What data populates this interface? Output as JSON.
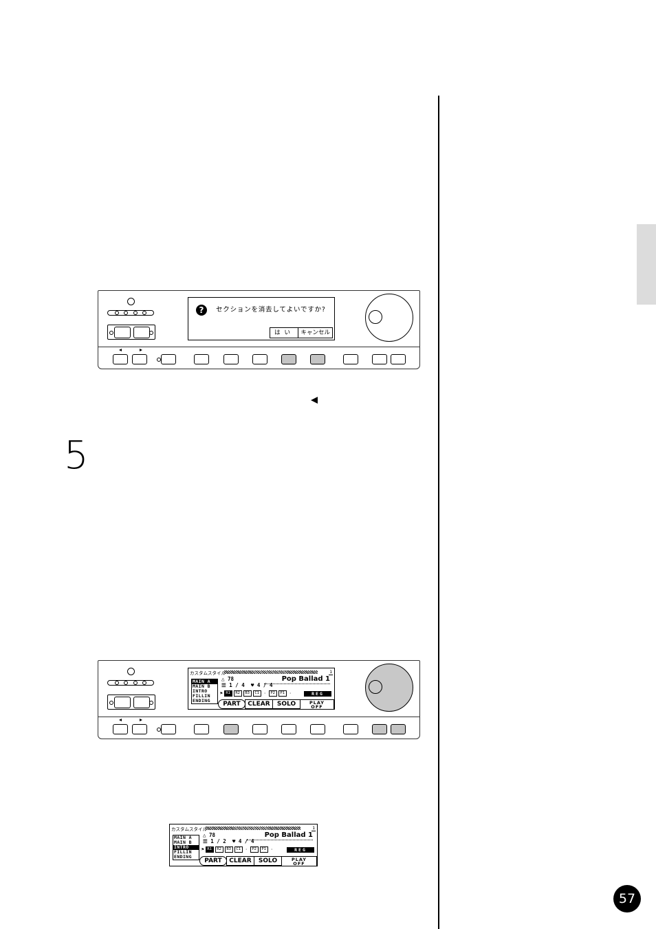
{
  "page": {
    "number": "57",
    "step_number": "5",
    "side_tab_color": "#dcdcdc"
  },
  "panel1": {
    "dialog": {
      "icon": "question-icon",
      "question_glyph": "?",
      "message": "セクションを消去してよいですか?",
      "yes_label": "はい",
      "cancel_label": "キャンセル"
    },
    "highlighted_buttons": [
      "function-4",
      "function-5"
    ],
    "knob_highlighted": false
  },
  "panel2": {
    "lcd": {
      "title": "カスタムスタイル",
      "page_indicator": "1",
      "tempo": "78",
      "measure": "1 / 4",
      "beat": "4 / 4",
      "style_name": "Pop Ballad 1",
      "sections": [
        "MAIN A",
        "MAIN B",
        "INTRO",
        "FILLIN",
        "ENDING"
      ],
      "selected_section": "MAIN A",
      "parts": [
        "R1",
        "R2",
        "B3",
        "C1",
        "·",
        "P2",
        "P1",
        "·"
      ],
      "reg_label": "REG",
      "menu": {
        "part": "PART",
        "clear": "CLEAR",
        "solo": "SOLO",
        "play_line1": "PLAY",
        "play_line2": "OFF"
      }
    },
    "highlighted_buttons": [
      "function-1",
      "up-down"
    ],
    "knob_highlighted": true
  },
  "lcd3": {
    "title": "カスタムスタイル",
    "page_indicator": "1",
    "tempo": "78",
    "measure": "1 / 2",
    "beat": "4 / 4",
    "style_name": "Pop Ballad 1",
    "sections": [
      "MAIN A",
      "MAIN B",
      "INTRO",
      "FILLIN",
      "ENDING"
    ],
    "selected_section": "INTRO",
    "parts": [
      "R1",
      "R2",
      "B3",
      "C1",
      "·",
      "P2",
      "P1",
      "·"
    ],
    "reg_label": "REG",
    "menu": {
      "part": "PART",
      "clear": "CLEAR",
      "solo": "SOLO",
      "play_line1": "PLAY",
      "play_line2": "OFF"
    }
  }
}
